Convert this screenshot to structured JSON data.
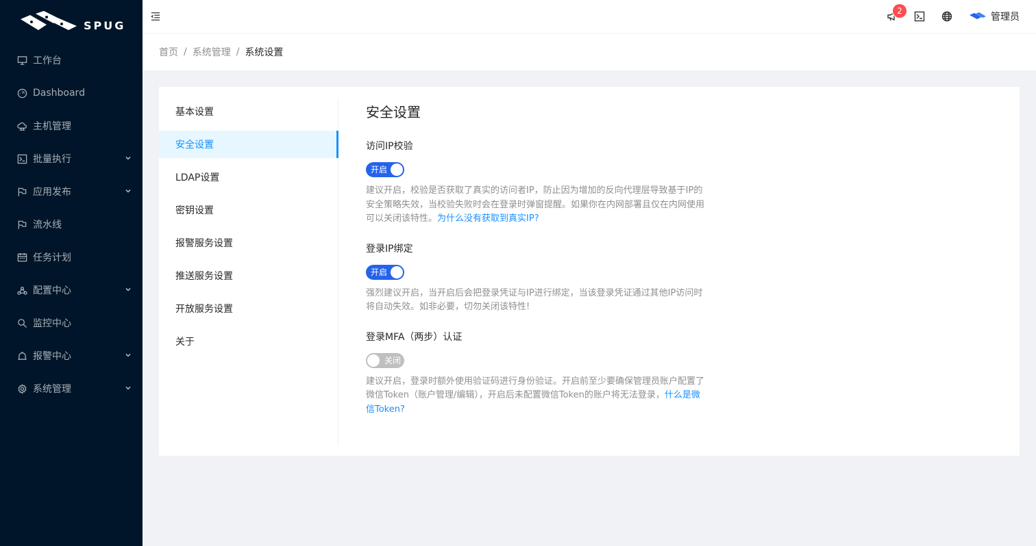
{
  "app": {
    "logo_text": "SPUG"
  },
  "sidebar": {
    "items": [
      {
        "label": "工作台",
        "icon": "desktop-icon",
        "has_submenu": false
      },
      {
        "label": "Dashboard",
        "icon": "dashboard-icon",
        "has_submenu": false
      },
      {
        "label": "主机管理",
        "icon": "cloud-server-icon",
        "has_submenu": false
      },
      {
        "label": "批量执行",
        "icon": "code-icon",
        "has_submenu": true
      },
      {
        "label": "应用发布",
        "icon": "flag-icon",
        "has_submenu": true
      },
      {
        "label": "流水线",
        "icon": "flag-icon",
        "has_submenu": false
      },
      {
        "label": "任务计划",
        "icon": "schedule-icon",
        "has_submenu": false
      },
      {
        "label": "配置中心",
        "icon": "deployment-unit-icon",
        "has_submenu": true
      },
      {
        "label": "监控中心",
        "icon": "monitor-icon",
        "has_submenu": false
      },
      {
        "label": "报警中心",
        "icon": "alert-icon",
        "has_submenu": true
      },
      {
        "label": "系统管理",
        "icon": "setting-icon",
        "has_submenu": true
      }
    ]
  },
  "header": {
    "notification_count": "2",
    "username": "管理员"
  },
  "breadcrumb": [
    "首页",
    "系统管理",
    "系统设置"
  ],
  "settings_nav": {
    "items": [
      "基本设置",
      "安全设置",
      "LDAP设置",
      "密钥设置",
      "报警服务设置",
      "推送服务设置",
      "开放服务设置",
      "关于"
    ],
    "selected": "安全设置"
  },
  "security": {
    "title": "安全设置",
    "ip_check": {
      "label": "访问IP校验",
      "switch_text": "开启",
      "desc": "建议开启，校验是否获取了真实的访问者IP，防止因为增加的反向代理层导致基于IP的安全策略失效，当校验失败时会在登录时弹窗提醒。如果你在内网部署且仅在内网使用可以关闭该特性。",
      "link": "为什么没有获取到真实IP?"
    },
    "ip_bind": {
      "label": "登录IP绑定",
      "switch_text": "开启",
      "desc": "强烈建议开启，当开启后会把登录凭证与IP进行绑定，当该登录凭证通过其他IP访问时将自动失效。如非必要，切勿关闭该特性!"
    },
    "mfa": {
      "label": "登录MFA（两步）认证",
      "switch_text": "关闭",
      "desc": "建议开启，登录时额外使用验证码进行身份验证。开启前至少要确保管理员账户配置了微信Token（账户管理/编辑），开启后未配置微信Token的账户将无法登录，",
      "link": "什么是微信Token?"
    }
  },
  "colors": {
    "primary": "#1890ff",
    "switch_on": "#2563eb",
    "sidebar_bg": "#001529",
    "badge": "#ff4d4f"
  }
}
